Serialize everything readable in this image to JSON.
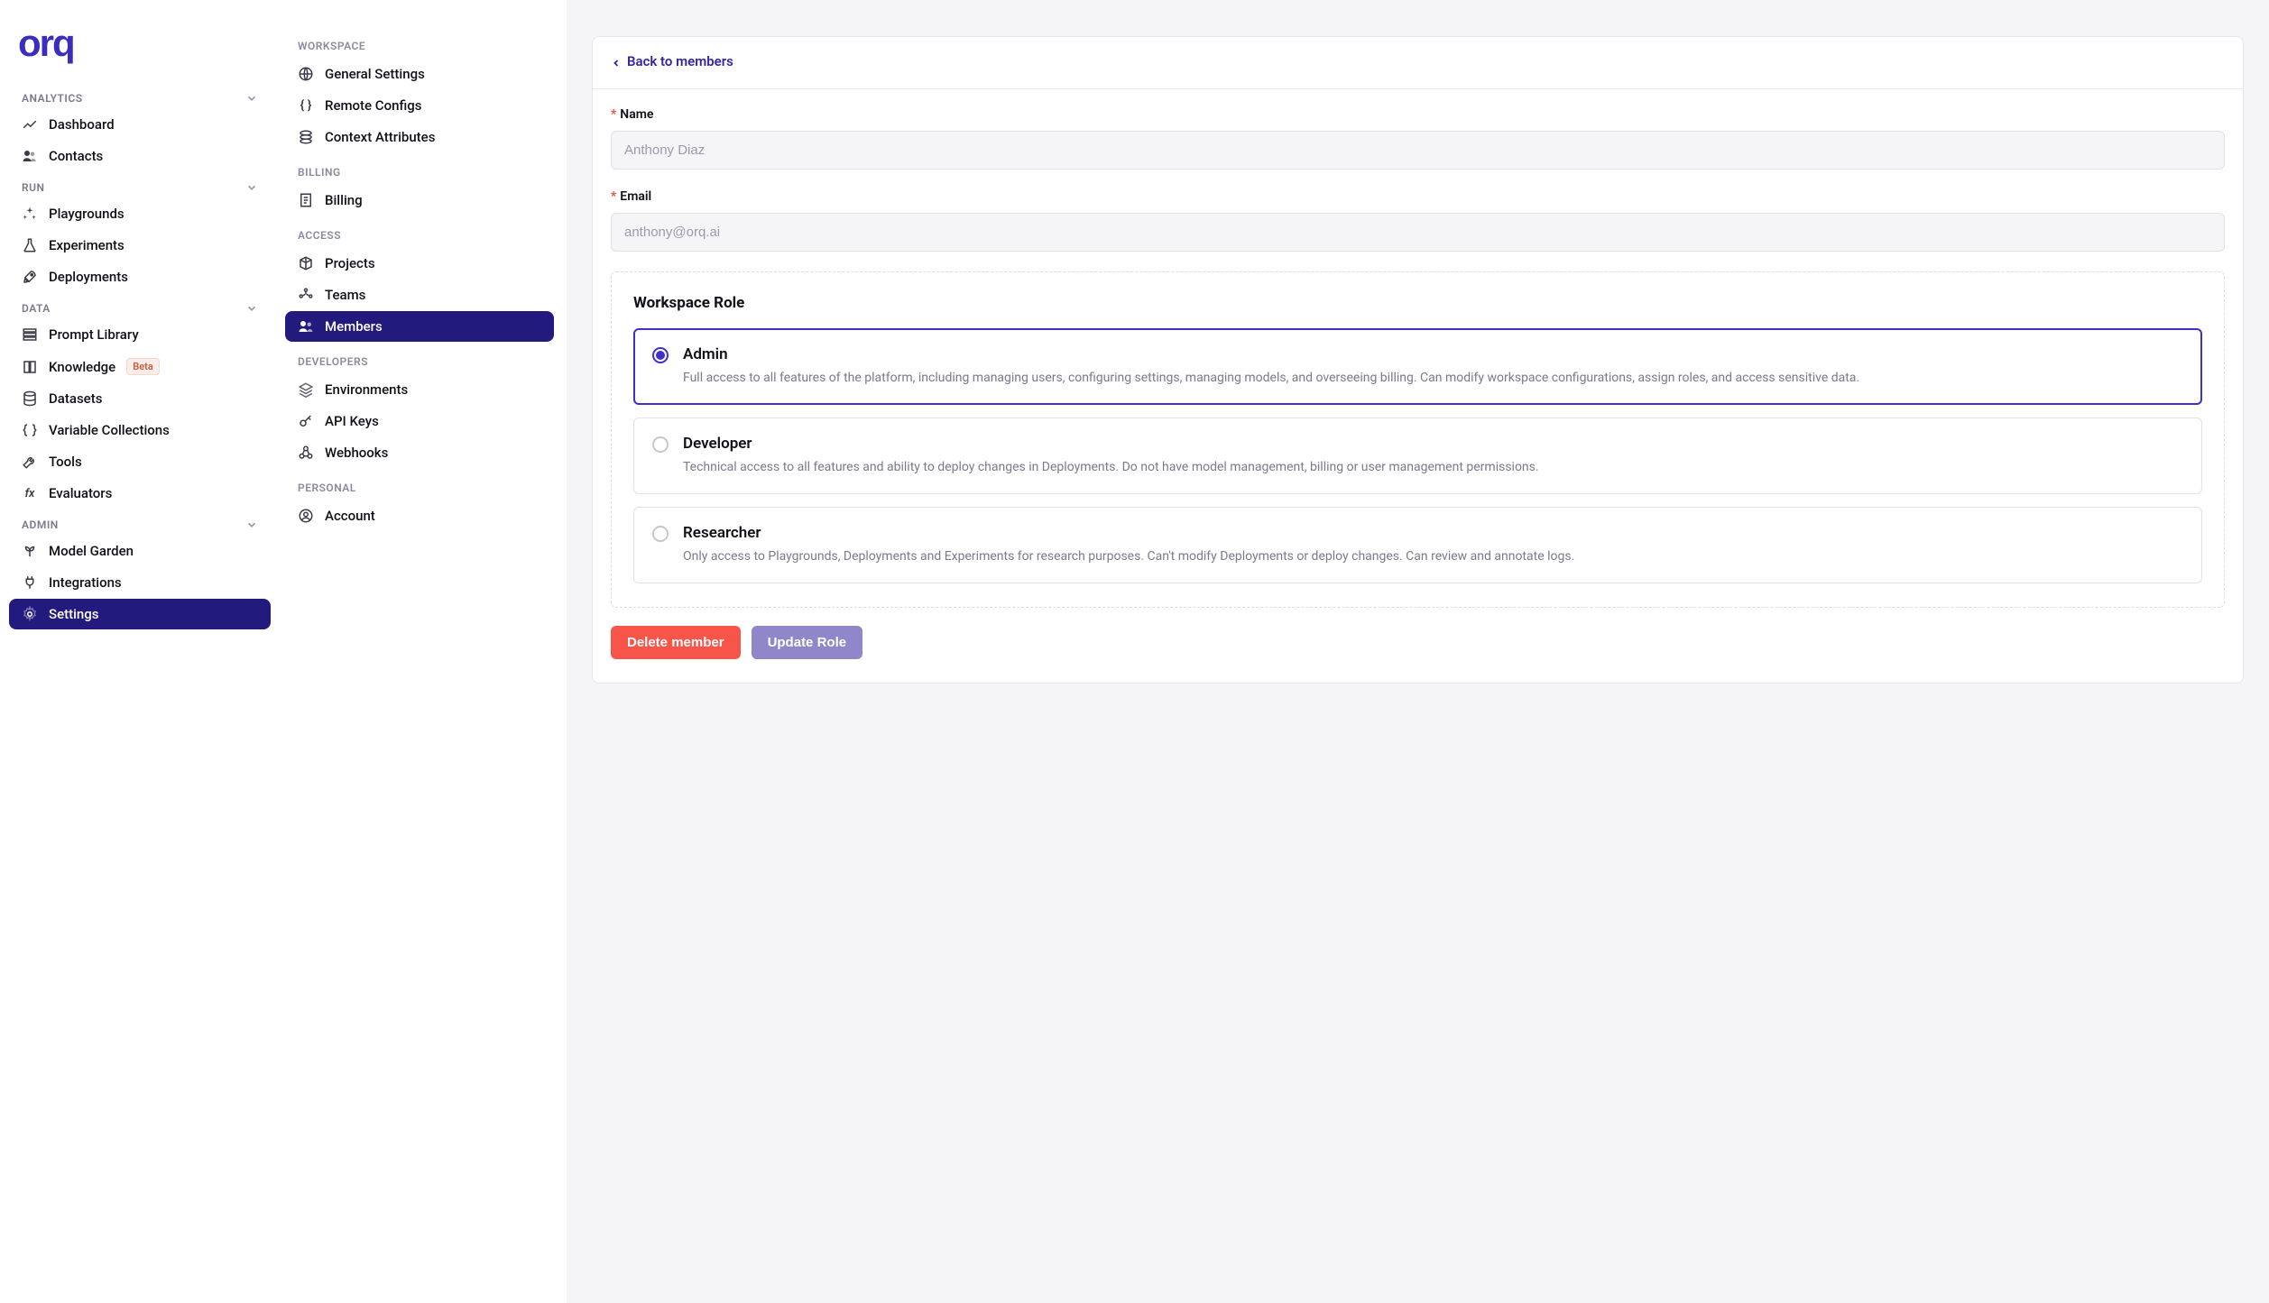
{
  "logo": "orq",
  "sidebar_primary": {
    "groups": [
      {
        "title": "ANALYTICS",
        "items": [
          {
            "icon": "chart-icon",
            "label": "Dashboard"
          },
          {
            "icon": "users-icon",
            "label": "Contacts"
          }
        ]
      },
      {
        "title": "RUN",
        "items": [
          {
            "icon": "sparkle-icon",
            "label": "Playgrounds"
          },
          {
            "icon": "flask-icon",
            "label": "Experiments"
          },
          {
            "icon": "rocket-icon",
            "label": "Deployments"
          }
        ]
      },
      {
        "title": "DATA",
        "items": [
          {
            "icon": "library-icon",
            "label": "Prompt Library"
          },
          {
            "icon": "book-icon",
            "label": "Knowledge",
            "badge": "Beta"
          },
          {
            "icon": "database-icon",
            "label": "Datasets"
          },
          {
            "icon": "braces-icon",
            "label": "Variable Collections"
          },
          {
            "icon": "wrench-icon",
            "label": "Tools"
          },
          {
            "icon": "fx-icon",
            "label": "Evaluators"
          }
        ]
      },
      {
        "title": "ADMIN",
        "items": [
          {
            "icon": "sprout-icon",
            "label": "Model Garden"
          },
          {
            "icon": "plug-icon",
            "label": "Integrations"
          },
          {
            "icon": "gear-icon",
            "label": "Settings",
            "active": true
          }
        ]
      }
    ]
  },
  "sidebar_secondary": {
    "groups": [
      {
        "title": "WORKSPACE",
        "items": [
          {
            "icon": "globe-icon",
            "label": "General Settings"
          },
          {
            "icon": "braces-icon",
            "label": "Remote Configs"
          },
          {
            "icon": "context-icon",
            "label": "Context Attributes"
          }
        ]
      },
      {
        "title": "BILLING",
        "items": [
          {
            "icon": "receipt-icon",
            "label": "Billing"
          }
        ]
      },
      {
        "title": "ACCESS",
        "items": [
          {
            "icon": "cube-icon",
            "label": "Projects"
          },
          {
            "icon": "teams-icon",
            "label": "Teams"
          },
          {
            "icon": "members-icon",
            "label": "Members",
            "active": true
          }
        ]
      },
      {
        "title": "DEVELOPERS",
        "items": [
          {
            "icon": "layers-icon",
            "label": "Environments"
          },
          {
            "icon": "key-icon",
            "label": "API Keys"
          },
          {
            "icon": "webhook-icon",
            "label": "Webhooks"
          }
        ]
      },
      {
        "title": "PERSONAL",
        "items": [
          {
            "icon": "avatar-icon",
            "label": "Account"
          }
        ]
      }
    ]
  },
  "main": {
    "back_label": "Back to members",
    "fields": {
      "name_label": "Name",
      "name_value": "Anthony Diaz",
      "email_label": "Email",
      "email_value": "anthony@orq.ai"
    },
    "roles": {
      "title": "Workspace Role",
      "options": [
        {
          "name": "Admin",
          "desc": "Full access to all features of the platform, including managing users, configuring settings, managing models, and overseeing billing. Can modify workspace configurations, assign roles, and access sensitive data.",
          "selected": true
        },
        {
          "name": "Developer",
          "desc": "Technical access to all features and ability to deploy changes in Deployments. Do not have model management, billing or user management permissions.",
          "selected": false
        },
        {
          "name": "Researcher",
          "desc": "Only access to Playgrounds, Deployments and Experiments for research purposes. Can't modify Deployments or deploy changes. Can review and annotate logs.",
          "selected": false
        }
      ]
    },
    "actions": {
      "delete": "Delete member",
      "update": "Update Role"
    }
  }
}
